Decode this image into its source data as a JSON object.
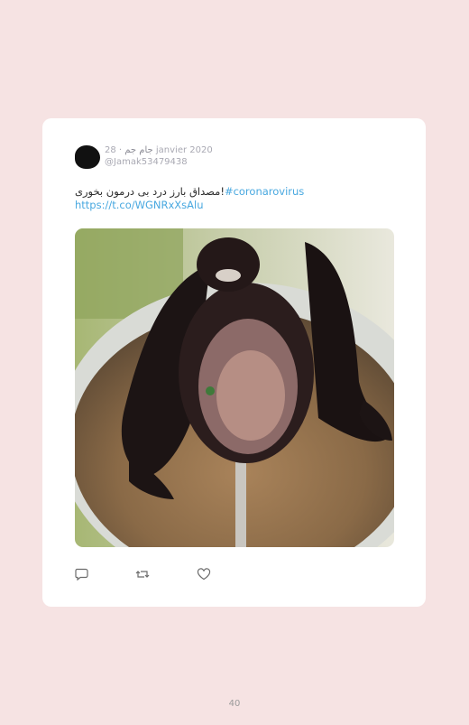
{
  "tweet": {
    "author_name": "جام جم",
    "date": "· 28 janvier 2020",
    "handle": "@Jamak53479438",
    "text": "مصداق بارز درد بی درمون بخوری!",
    "hashtag": "#coronarovirus",
    "link": "https://t.co/WGNRxXsAlu",
    "media_description_icon": "bat-in-soup-photo"
  },
  "actions": {
    "reply_icon": "reply-icon",
    "retweet_icon": "retweet-icon",
    "like_icon": "heart-icon"
  },
  "page": {
    "number": "40"
  },
  "colors": {
    "background": "#f6e3e3",
    "card": "#ffffff",
    "link": "#48a8e0",
    "meta": "#a9a9b3"
  }
}
